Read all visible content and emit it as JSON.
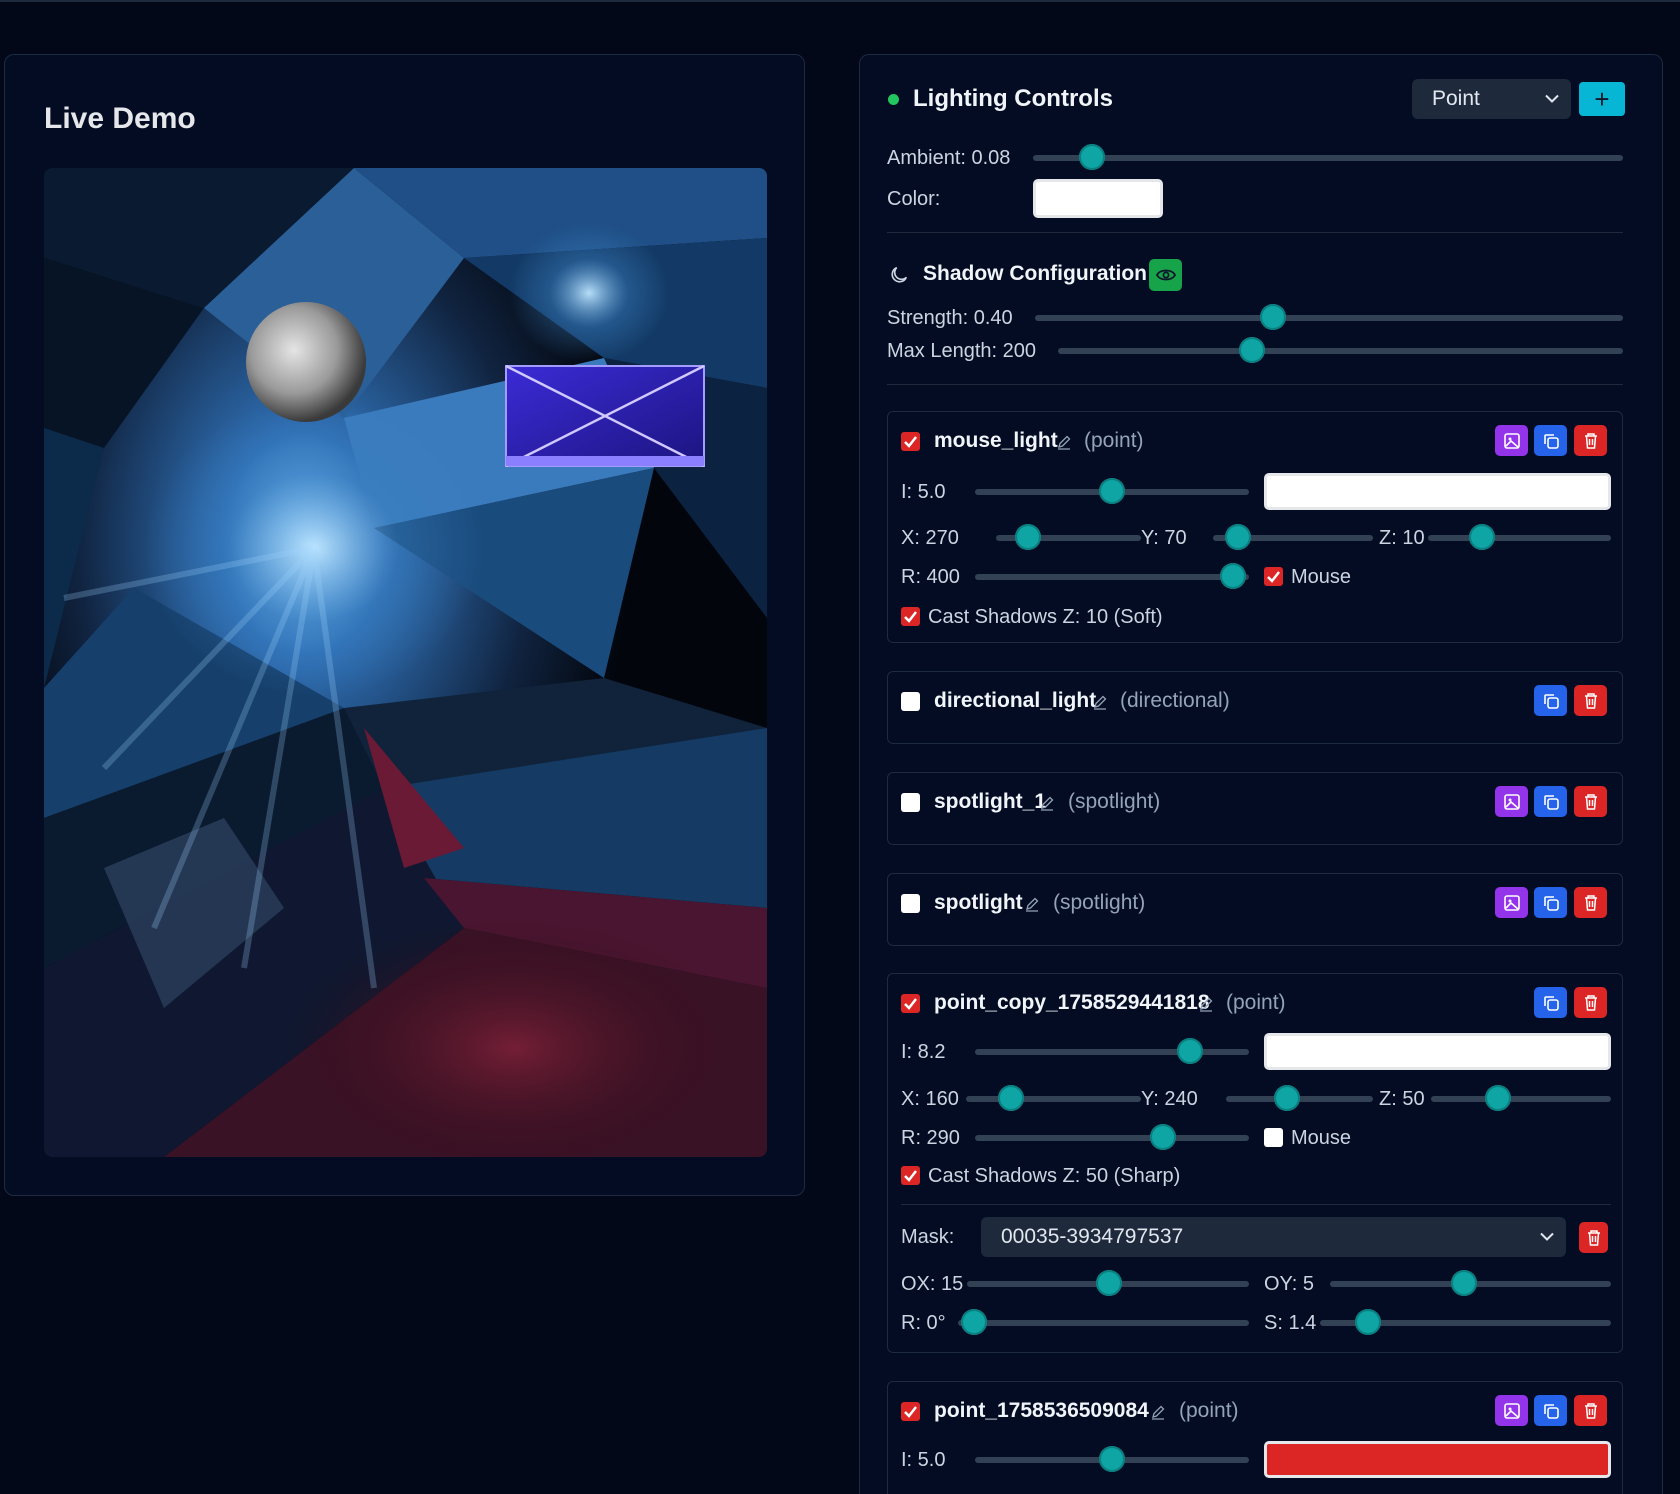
{
  "left": {
    "title": "Live Demo"
  },
  "controls": {
    "title": "Lighting Controls",
    "light_type_select": "Point",
    "add_label": "+",
    "ambient_label": "Ambient: 0.08",
    "ambient_value": 0.08,
    "color_label": "Color:",
    "ambient_color": "#ffffff"
  },
  "shadow": {
    "title": "Shadow Configuration",
    "strength_label": "Strength: 0.40",
    "max_length_label": "Max Length: 200"
  },
  "lights": [
    {
      "name": "mouse_light",
      "type": "(point)",
      "enabled": true,
      "intensity_label": "I: 5.0",
      "color": "#ffffff",
      "x_label": "X: 270",
      "y_label": "Y: 70",
      "z_label": "Z: 10",
      "r_label": "R: 400",
      "mouse_label": "Mouse",
      "mouse": true,
      "cast_label": "Cast Shadows Z: 10 (Soft)",
      "cast": true
    },
    {
      "name": "directional_light",
      "type": "(directional)",
      "enabled": false
    },
    {
      "name": "spotlight_1",
      "type": "(spotlight)",
      "enabled": false
    },
    {
      "name": "spotlight",
      "type": "(spotlight)",
      "enabled": false
    },
    {
      "name": "point_copy_1758529441818",
      "type": "(point)",
      "enabled": true,
      "intensity_label": "I: 8.2",
      "color": "#ffffff",
      "x_label": "X: 160",
      "y_label": "Y: 240",
      "z_label": "Z: 50",
      "r_label": "R: 290",
      "mouse_label": "Mouse",
      "mouse": false,
      "cast_label": "Cast Shadows Z: 50 (Sharp)",
      "cast": true,
      "mask_label": "Mask:",
      "mask_value": "00035-3934797537",
      "ox_label": "OX: 15",
      "oy_label": "OY: 5",
      "rot_label": "R: 0°",
      "scale_label": "S: 1.4"
    },
    {
      "name": "point_1758536509084",
      "type": "(point)",
      "enabled": true,
      "intensity_label": "I: 5.0",
      "color": "#dc2626"
    }
  ]
}
